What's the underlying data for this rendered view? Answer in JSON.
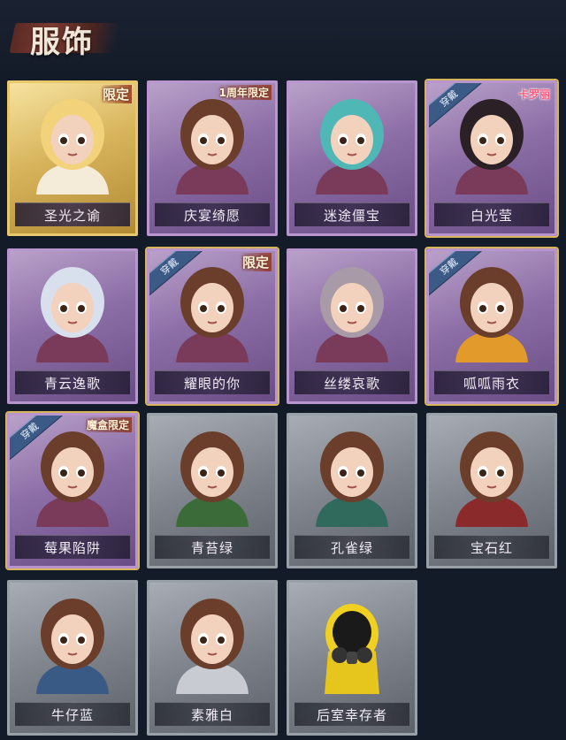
{
  "header": {
    "title": "服饰"
  },
  "costumes": [
    {
      "name": "圣光之谕",
      "tag": "限定",
      "ribbon": "",
      "brand": "",
      "style": "gold",
      "icon": "goddess-portrait-icon"
    },
    {
      "name": "庆宴绮愿",
      "tag": "1周年限定",
      "ribbon": "",
      "brand": "",
      "style": "purple",
      "icon": "birthday-cake-portrait-icon"
    },
    {
      "name": "迷途僵宝",
      "tag": "",
      "ribbon": "",
      "brand": "",
      "style": "purple",
      "icon": "teal-hair-portrait-icon"
    },
    {
      "name": "白光莹",
      "tag": "",
      "ribbon": "穿戴",
      "brand": "卡罗丽",
      "style": "purple",
      "icon": "crowned-girl-portrait-icon"
    },
    {
      "name": "青云逸歌",
      "tag": "",
      "ribbon": "",
      "brand": "",
      "style": "purple",
      "icon": "silver-hair-portrait-icon"
    },
    {
      "name": "耀眼的你",
      "tag": "限定",
      "ribbon": "穿戴",
      "brand": "",
      "style": "purple",
      "icon": "cowboy-hat-portrait-icon"
    },
    {
      "name": "丝缕哀歌",
      "tag": "",
      "ribbon": "",
      "brand": "",
      "style": "purple",
      "icon": "lace-headband-portrait-icon"
    },
    {
      "name": "呱呱雨衣",
      "tag": "",
      "ribbon": "穿戴",
      "brand": "",
      "style": "purple",
      "icon": "frog-hat-portrait-icon"
    },
    {
      "name": "莓果陷阱",
      "tag": "魔盒限定",
      "ribbon": "穿戴",
      "brand": "",
      "style": "purple",
      "icon": "witch-hat-portrait-icon"
    },
    {
      "name": "青苔绿",
      "tag": "",
      "ribbon": "",
      "brand": "",
      "style": "grey",
      "icon": "green-coat-portrait-icon"
    },
    {
      "name": "孔雀绿",
      "tag": "",
      "ribbon": "",
      "brand": "",
      "style": "grey",
      "icon": "peacock-coat-portrait-icon"
    },
    {
      "name": "宝石红",
      "tag": "",
      "ribbon": "",
      "brand": "",
      "style": "grey",
      "icon": "red-coat-portrait-icon"
    },
    {
      "name": "牛仔蓝",
      "tag": "",
      "ribbon": "",
      "brand": "",
      "style": "grey",
      "icon": "blue-coat-portrait-icon"
    },
    {
      "name": "素雅白",
      "tag": "",
      "ribbon": "",
      "brand": "",
      "style": "grey",
      "icon": "white-coat-portrait-icon"
    },
    {
      "name": "后室幸存者",
      "tag": "",
      "ribbon": "",
      "brand": "",
      "style": "grey",
      "icon": "gas-mask-portrait-icon"
    }
  ],
  "colors": {
    "background": "#131b28",
    "purple_card": "#8d6fa7",
    "gold_card": "#d8b55d",
    "grey_card": "#7e838c",
    "ribbon": "#3c5a86"
  }
}
